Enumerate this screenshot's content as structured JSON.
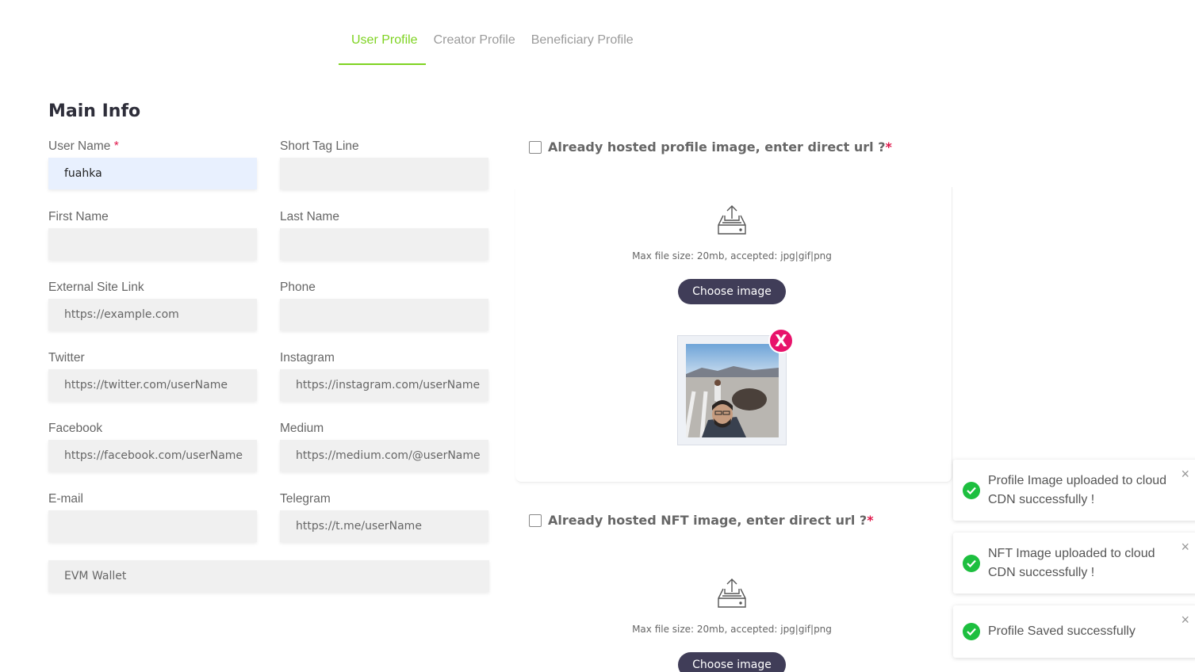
{
  "tabs": [
    "User Profile",
    "Creator Profile",
    "Beneficiary Profile"
  ],
  "active_tab": "User Profile",
  "section_title": "Main Info",
  "fields": {
    "user_name": {
      "label": "User Name",
      "required": "*",
      "value": "fuahka"
    },
    "short_tag_line": {
      "label": "Short Tag Line",
      "placeholder": ""
    },
    "first_name": {
      "label": "First Name",
      "placeholder": ""
    },
    "last_name": {
      "label": "Last Name",
      "placeholder": ""
    },
    "external_site": {
      "label": "External Site Link",
      "placeholder": "https://example.com"
    },
    "phone": {
      "label": "Phone",
      "placeholder": ""
    },
    "twitter": {
      "label": "Twitter",
      "placeholder": "https://twitter.com/userName"
    },
    "instagram": {
      "label": "Instagram",
      "placeholder": "https://instagram.com/userName"
    },
    "facebook": {
      "label": "Facebook",
      "placeholder": "https://facebook.com/userName"
    },
    "medium": {
      "label": "Medium",
      "placeholder": "https://medium.com/@userName"
    },
    "email": {
      "label": "E-mail",
      "placeholder": ""
    },
    "telegram": {
      "label": "Telegram",
      "placeholder": "https://t.me/userName"
    },
    "evm_wallet": {
      "placeholder": "EVM Wallet"
    }
  },
  "profile_image": {
    "hosted_label": "Already hosted profile image, enter direct url ?",
    "required": "*",
    "max_size_text": "Max file size: 20mb, accepted: jpg|gif|png",
    "choose_label": "Choose image",
    "remove_label": "X"
  },
  "nft_image": {
    "hosted_label": "Already hosted NFT image, enter direct url ?",
    "required": "*",
    "max_size_text": "Max file size: 20mb, accepted: jpg|gif|png",
    "choose_label": "Choose image"
  },
  "toasts": [
    {
      "message": "Profile Image uploaded to cloud CDN successfully !",
      "close": "×"
    },
    {
      "message": "NFT Image uploaded to cloud CDN successfully !",
      "close": "×"
    },
    {
      "message": "Profile Saved successfully",
      "close": "×"
    }
  ],
  "colors": {
    "accent": "#7ed321",
    "button": "#403d58",
    "required": "#e0164a",
    "success": "#1dbf3f",
    "remove": "#e8136b"
  }
}
